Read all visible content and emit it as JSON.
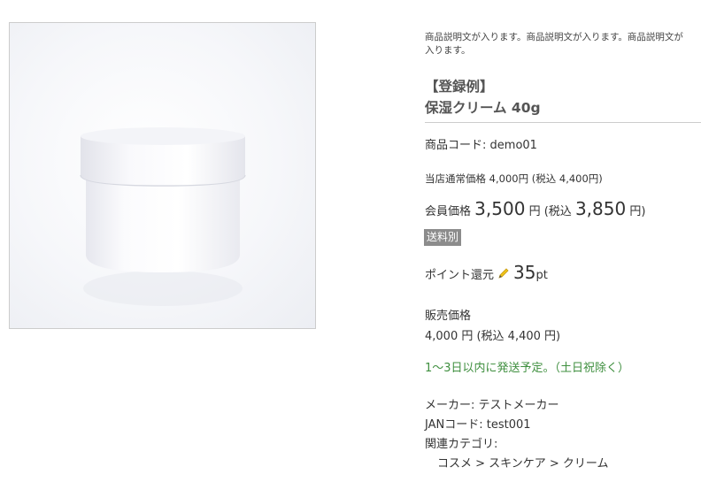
{
  "product": {
    "description": "商品説明文が入ります。商品説明文が入ります。商品説明文が入ります。",
    "title_tag": "【登録例】",
    "title": "保湿クリーム 40g",
    "code_label": "商品コード:",
    "code_value": "demo01",
    "regular_price_text": "当店通常価格 4,000円 (税込 4,400円)",
    "member_label": "会員価格",
    "member_price": "3,500",
    "member_yen": "円",
    "member_tax_open": "(税込",
    "member_price_tax": "3,850",
    "member_tax_close": "円)",
    "shipping_badge": "送料別",
    "points_label": "ポイント還元",
    "points_value": "35",
    "points_unit": "pt",
    "sale_label": "販売価格",
    "sale_value": "4,000 円 (税込 4,400 円)",
    "ship_note": "1〜3日以内に発送予定。（土日祝除く）",
    "maker_text": "メーカー: テストメーカー",
    "jan_text": "JANコード: test001",
    "category_label": "関連カテゴリ:",
    "category_path": "コスメ > スキンケア > クリーム"
  },
  "icons": {
    "points": "pencil-icon"
  },
  "colors": {
    "ship_note": "#3f8f3f",
    "badge_bg": "#8c8c8c",
    "text": "#333333"
  }
}
